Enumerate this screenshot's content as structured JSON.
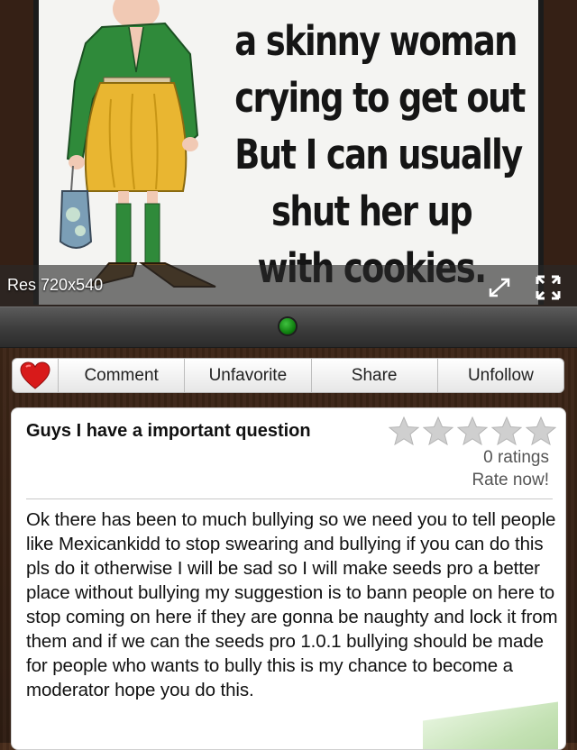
{
  "viewer": {
    "meme_lines": [
      "a skinny woman",
      "crying to get out",
      "But I can usually",
      "shut her up",
      "with cookies."
    ],
    "res_prefix": "Res",
    "res_value": "720x540"
  },
  "actions": {
    "heart_icon": "heart-icon",
    "comment": "Comment",
    "unfavorite": "Unfavorite",
    "share": "Share",
    "unfollow": "Unfollow"
  },
  "post": {
    "title": "Guys I have a important question",
    "ratings_count": "0 ratings",
    "rate_now": "Rate now!",
    "body": "Ok there has been to much bullying so we need you to tell people like Mexicankidd to stop swearing and bullying if you can do this pls do it otherwise I will be sad so I will make seeds pro a better place without bullying my suggestion is to bann people on here to stop coming on here if they are gonna be naughty and lock it from them and if we can the seeds pro 1.0.1 bullying should  be made for people who wants to bully this is my chance to become a moderator hope you do this."
  },
  "colors": {
    "heart": "#d81a1a",
    "page_dot": "#1f9a1f",
    "star": "#cfcfcf"
  }
}
